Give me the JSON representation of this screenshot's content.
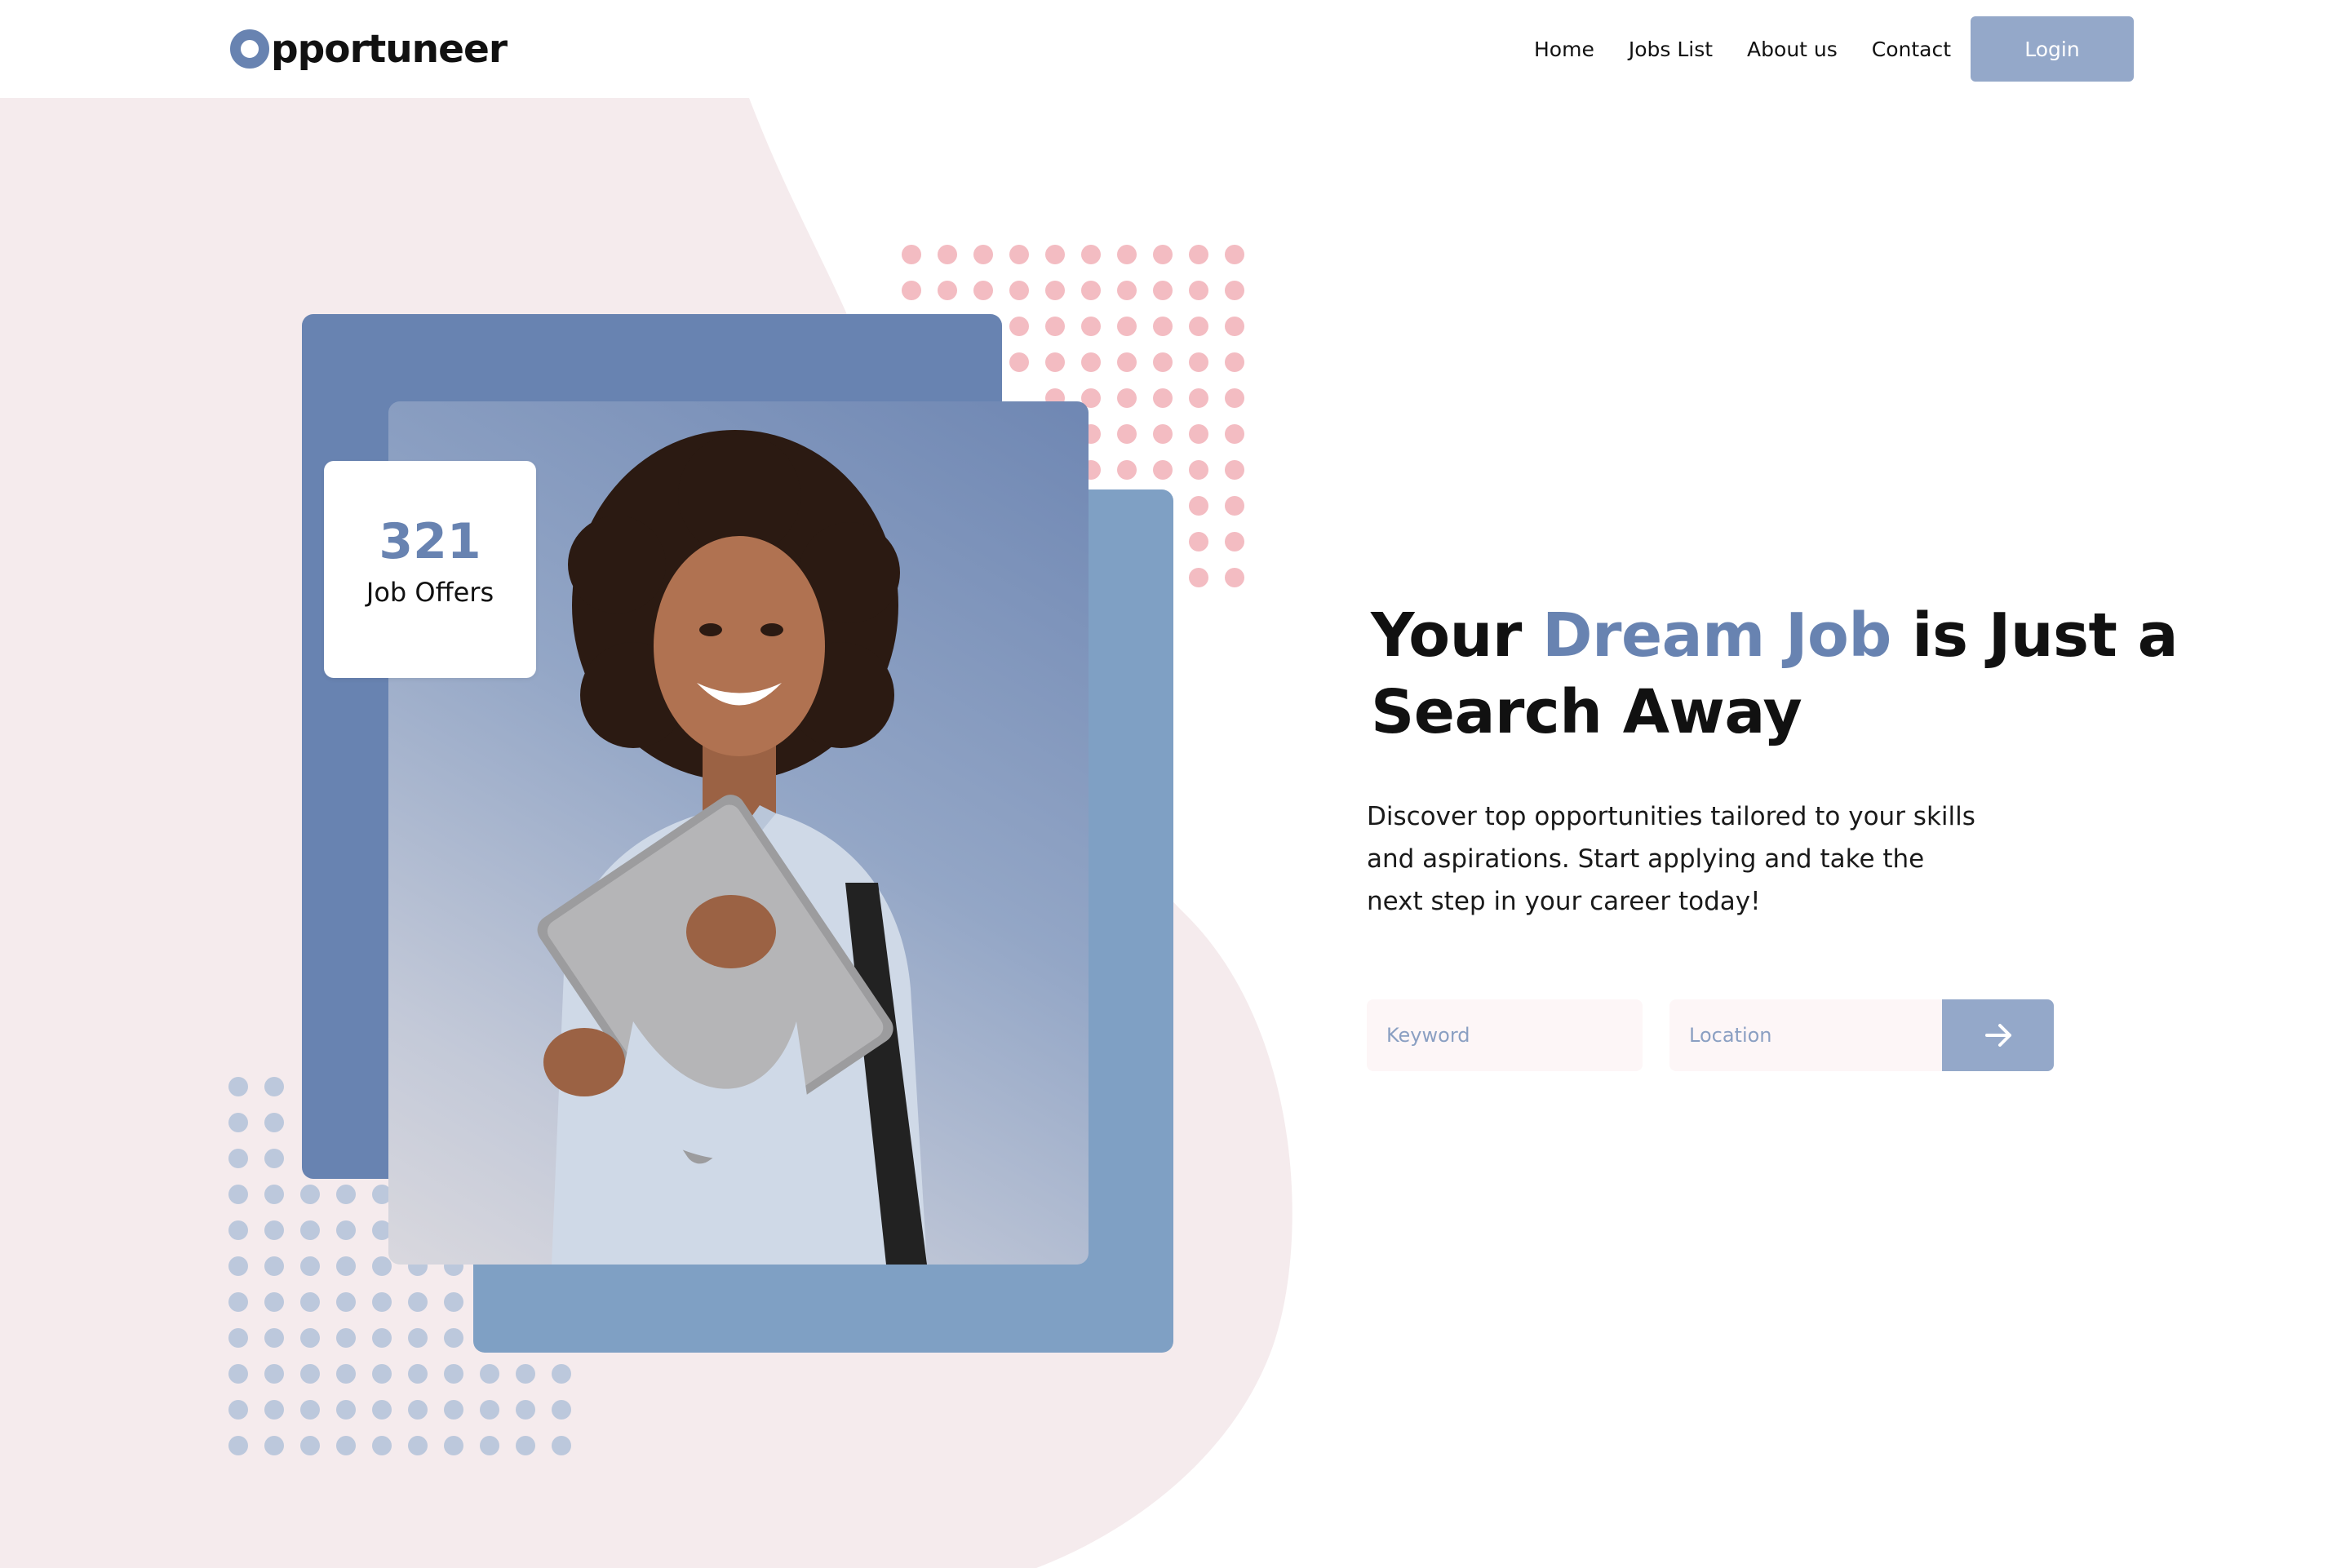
{
  "brand": {
    "logo_text": "pportuneer",
    "logo_initial_icon": "o-ring-icon"
  },
  "nav": {
    "items": [
      {
        "label": "Home"
      },
      {
        "label": "Jobs List"
      },
      {
        "label": "About us"
      },
      {
        "label": "Contact"
      }
    ],
    "login_label": "Login"
  },
  "stats": {
    "count": "321",
    "label": "Job Offers"
  },
  "hero": {
    "title_before": "Your ",
    "title_accent": "Dream Job",
    "title_after": " is Just a Search Away",
    "subtitle": "Discover top opportunities tailored to your skills and aspirations. Start applying and take the next step in your career today!"
  },
  "search": {
    "keyword_placeholder": "Keyword",
    "location_placeholder": "Location",
    "submit_icon": "arrow-right-icon"
  },
  "colors": {
    "accent": "#6883b1",
    "accent_light": "#7fa0c4",
    "button": "#94a8c9",
    "blob": "#f5ebed",
    "pink_dots": "#f3bcc2",
    "blue_dots": "#bcc8dc"
  }
}
